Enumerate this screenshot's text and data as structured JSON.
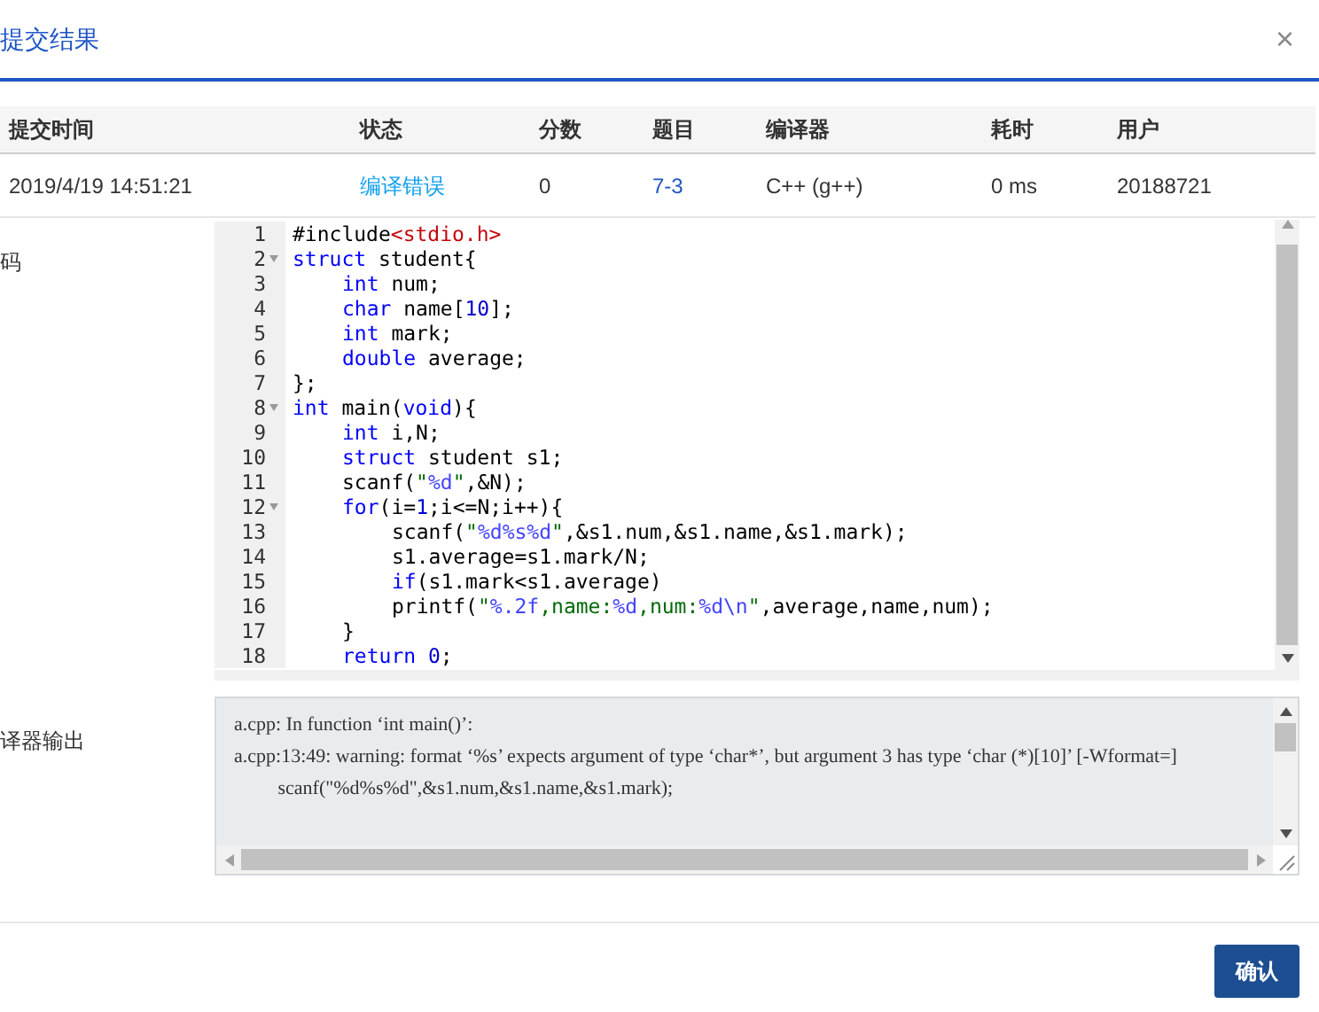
{
  "dialog": {
    "title": "提交结果",
    "close": "×"
  },
  "table": {
    "columns": [
      "提交时间",
      "状态",
      "分数",
      "题目",
      "编译器",
      "耗时",
      "用户"
    ],
    "rows": [
      {
        "cells": [
          {
            "text": "2019/4/19 14:51:21",
            "kind": "plain"
          },
          {
            "text": "编译错误",
            "kind": "status"
          },
          {
            "text": "0",
            "kind": "plain"
          },
          {
            "text": "7-3",
            "kind": "link"
          },
          {
            "text": "C++ (g++)",
            "kind": "plain"
          },
          {
            "text": "0 ms",
            "kind": "plain"
          },
          {
            "text": "20188721",
            "kind": "plain"
          }
        ]
      }
    ]
  },
  "code": {
    "label": "码",
    "lines": [
      {
        "number": "1",
        "foldable": false,
        "tokens": [
          {
            "kind": "plain",
            "text": "#include"
          },
          {
            "kind": "include",
            "text": "<stdio.h>"
          }
        ]
      },
      {
        "number": "2",
        "foldable": true,
        "tokens": [
          {
            "kind": "keyword",
            "text": "struct"
          },
          {
            "kind": "plain",
            "text": " student{"
          }
        ],
        "children": [
          {
            "number": "3",
            "foldable": false,
            "tokens": [
              {
                "kind": "keyword",
                "text": "int"
              },
              {
                "kind": "plain",
                "text": " num;"
              }
            ]
          },
          {
            "number": "4",
            "foldable": false,
            "tokens": [
              {
                "kind": "keyword",
                "text": "char"
              },
              {
                "kind": "plain",
                "text": " name["
              },
              {
                "kind": "number",
                "text": "10"
              },
              {
                "kind": "plain",
                "text": "];"
              }
            ]
          },
          {
            "number": "5",
            "foldable": false,
            "tokens": [
              {
                "kind": "keyword",
                "text": "int"
              },
              {
                "kind": "plain",
                "text": " mark;"
              }
            ]
          },
          {
            "number": "6",
            "foldable": false,
            "tokens": [
              {
                "kind": "keyword",
                "text": "double"
              },
              {
                "kind": "plain",
                "text": " average;"
              }
            ]
          }
        ]
      },
      {
        "number": "7",
        "foldable": false,
        "tokens": [
          {
            "kind": "plain",
            "text": "};"
          }
        ]
      },
      {
        "number": "8",
        "foldable": true,
        "tokens": [
          {
            "kind": "keyword",
            "text": "int"
          },
          {
            "kind": "plain",
            "text": " main("
          },
          {
            "kind": "keyword",
            "text": "void"
          },
          {
            "kind": "plain",
            "text": "){"
          }
        ],
        "children": [
          {
            "number": "9",
            "foldable": false,
            "tokens": [
              {
                "kind": "keyword",
                "text": "int"
              },
              {
                "kind": "plain",
                "text": " i,N;"
              }
            ]
          },
          {
            "number": "10",
            "foldable": false,
            "tokens": [
              {
                "kind": "keyword",
                "text": "struct"
              },
              {
                "kind": "plain",
                "text": " student s1;"
              }
            ]
          },
          {
            "number": "11",
            "foldable": false,
            "tokens": [
              {
                "kind": "plain",
                "text": "scanf("
              },
              {
                "kind": "string",
                "text": "\""
              },
              {
                "kind": "format",
                "text": "%d"
              },
              {
                "kind": "string",
                "text": "\""
              },
              {
                "kind": "plain",
                "text": ",&N);"
              }
            ]
          },
          {
            "number": "12",
            "foldable": true,
            "tokens": [
              {
                "kind": "keyword",
                "text": "for"
              },
              {
                "kind": "plain",
                "text": "(i="
              },
              {
                "kind": "number",
                "text": "1"
              },
              {
                "kind": "plain",
                "text": ";i<=N;i++){"
              }
            ],
            "children": [
              {
                "number": "13",
                "foldable": false,
                "tokens": [
                  {
                    "kind": "plain",
                    "text": "scanf("
                  },
                  {
                    "kind": "string",
                    "text": "\""
                  },
                  {
                    "kind": "format",
                    "text": "%d%s%d"
                  },
                  {
                    "kind": "string",
                    "text": "\""
                  },
                  {
                    "kind": "plain",
                    "text": ",&s1.num,&s1.name,&s1.mark);"
                  }
                ]
              },
              {
                "number": "14",
                "foldable": false,
                "tokens": [
                  {
                    "kind": "plain",
                    "text": "s1.average=s1.mark/N;"
                  }
                ]
              },
              {
                "number": "15",
                "foldable": false,
                "tokens": [
                  {
                    "kind": "keyword",
                    "text": "if"
                  },
                  {
                    "kind": "plain",
                    "text": "(s1.mark<s1.average)"
                  }
                ]
              },
              {
                "number": "16",
                "foldable": false,
                "tokens": [
                  {
                    "kind": "plain",
                    "text": "printf("
                  },
                  {
                    "kind": "string",
                    "text": "\""
                  },
                  {
                    "kind": "format",
                    "text": "%.2f"
                  },
                  {
                    "kind": "string",
                    "text": ",name:"
                  },
                  {
                    "kind": "format",
                    "text": "%d"
                  },
                  {
                    "kind": "string",
                    "text": ",num:"
                  },
                  {
                    "kind": "format",
                    "text": "%d\\n"
                  },
                  {
                    "kind": "string",
                    "text": "\""
                  },
                  {
                    "kind": "plain",
                    "text": ",average,name,num);"
                  }
                ]
              }
            ]
          },
          {
            "number": "17",
            "foldable": false,
            "tokens": [
              {
                "kind": "plain",
                "text": "}"
              }
            ]
          },
          {
            "number": "18",
            "foldable": false,
            "tokens": [
              {
                "kind": "keyword",
                "text": "return"
              },
              {
                "kind": "number",
                "text": " 0"
              },
              {
                "kind": "plain",
                "text": ";"
              }
            ]
          }
        ]
      }
    ]
  },
  "compiler_output": {
    "label": "译器输出",
    "lines": [
      "a.cpp: In function ‘int main()’:",
      "a.cpp:13:49: warning: format ‘%s’ expects argument of type ‘char*’, but argument 3 has type ‘char (*)[10]’ [-Wformat=]",
      "         scanf(\"%d%s%d\",&s1.num,&s1.name,&s1.mark);"
    ]
  },
  "buttons": [
    {
      "label": "确认",
      "kind": "primary"
    }
  ]
}
